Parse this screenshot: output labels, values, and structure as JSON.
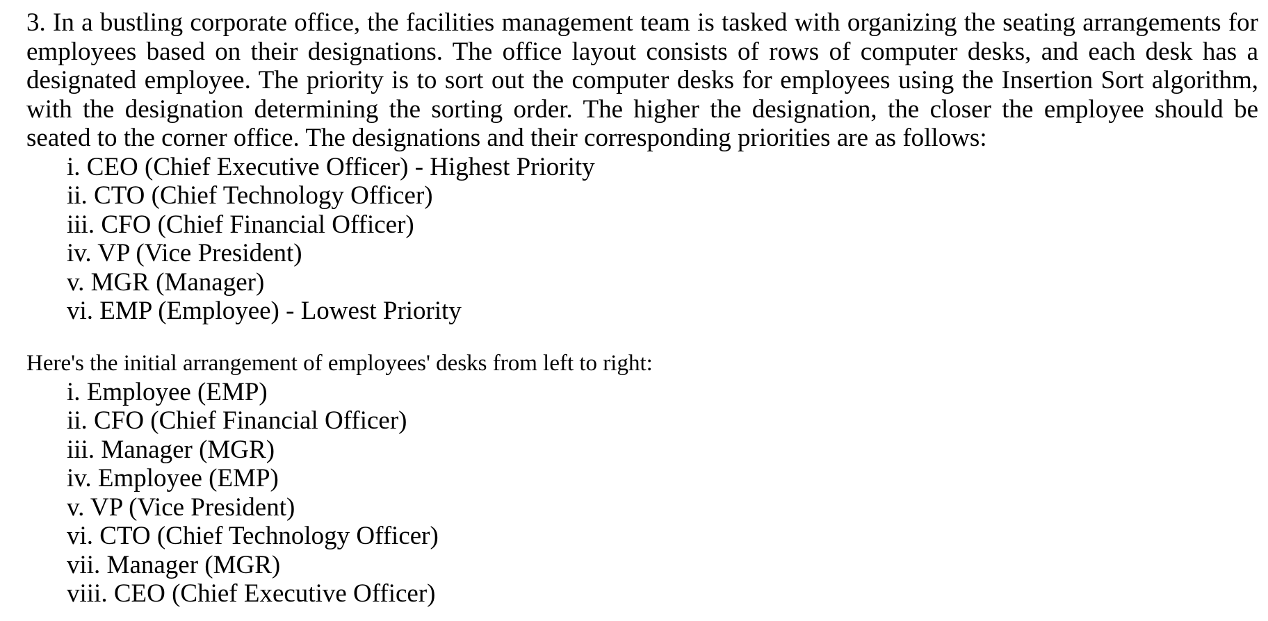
{
  "question": {
    "text": "3. In a bustling corporate office, the facilities management team is tasked with organizing the seating arrange­ments for employees based on their designations. The office layout consists of rows of computer desks, and each desk has a designated employee. The priority is to sort out the computer desks for employees using the Insertion Sort algorithm, with the designation determining the sorting order. The higher the designation, the closer the em­ployee should be seated to the corner office. The designations and their corresponding priorities are as follows:"
  },
  "priorities": [
    "i. CEO (Chief Executive Officer) - Highest Priority",
    "ii. CTO (Chief Technology Officer)",
    "iii. CFO (Chief Financial Officer)",
    "iv. VP (Vice President)",
    "v. MGR (Manager)",
    "vi. EMP (Employee) - Lowest Priority"
  ],
  "arrangement_heading": "Here's the initial arrangement of employees' desks from left to right:",
  "arrangement": [
    "i. Employee (EMP)",
    "ii. CFO (Chief Financial Officer)",
    "iii. Manager (MGR)",
    "iv. Employee (EMP)",
    "v. VP (Vice President)",
    "vi. CTO (Chief Technology Officer)",
    "vii. Manager (MGR)",
    "viii. CEO (Chief Executive Officer)"
  ]
}
